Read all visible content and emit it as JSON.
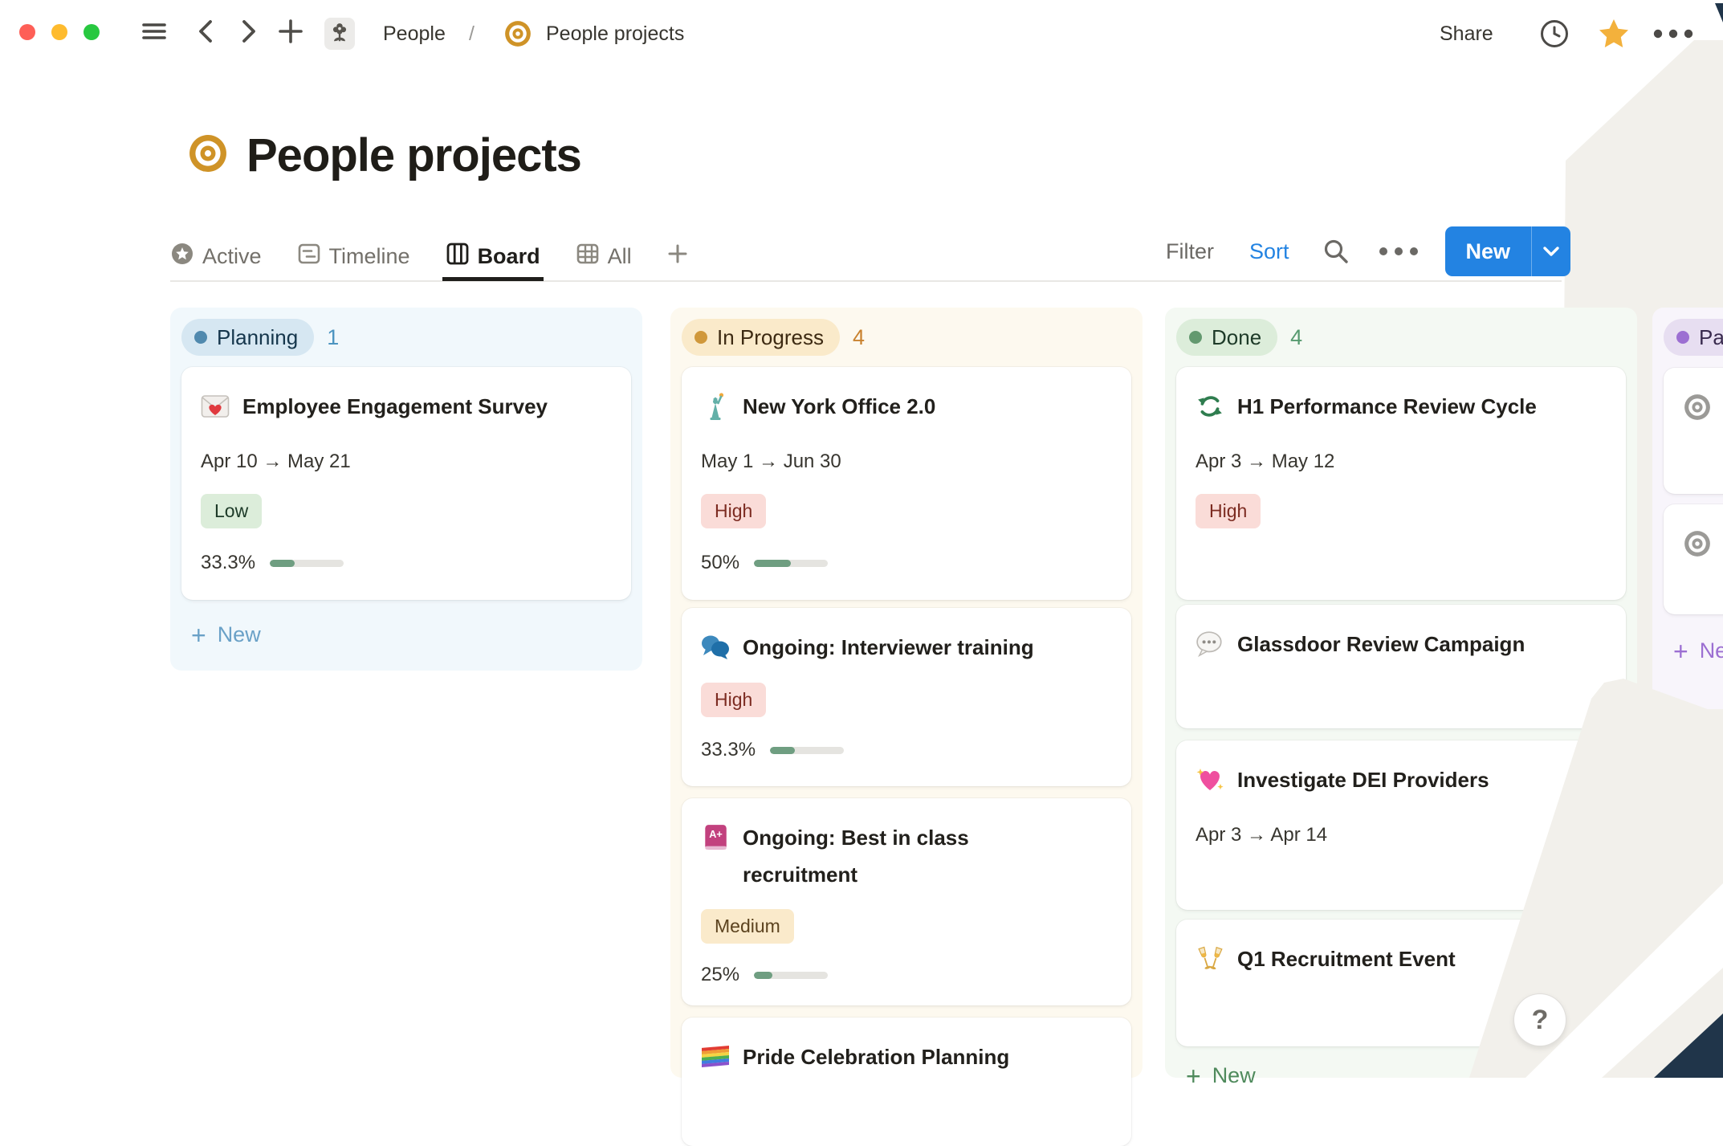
{
  "window": {
    "breadcrumb": {
      "root": "People",
      "separator": "/",
      "page": "People projects"
    },
    "share_label": "Share",
    "traffic_lights": {
      "close": "#fe5f57",
      "minimize": "#febb2e",
      "zoom": "#28c840"
    }
  },
  "header": {
    "title": "People projects",
    "icon": "target-icon"
  },
  "tabs": [
    {
      "label": "Active",
      "icon": "star-circle-icon",
      "active": false
    },
    {
      "label": "Timeline",
      "icon": "timeline-icon",
      "active": false
    },
    {
      "label": "Board",
      "icon": "board-icon",
      "active": true
    },
    {
      "label": "All",
      "icon": "table-icon",
      "active": false
    },
    {
      "label": "+",
      "icon": "plus-icon",
      "active": false
    }
  ],
  "toolbar": {
    "filter_label": "Filter",
    "sort_label": "Sort",
    "sort_color": "#2383e2",
    "new_label": "New",
    "new_button_color": "#2383e2"
  },
  "priorities": {
    "Low": {
      "bg": "#dcedda",
      "fg": "#1d3a28"
    },
    "Medium": {
      "bg": "#faeacb",
      "fg": "#5c431f"
    },
    "High": {
      "bg": "#fadcd8",
      "fg": "#7c2b21"
    }
  },
  "progress_colors": {
    "track": "#e5e4e0",
    "fill": "#6f9e81"
  },
  "board": {
    "columns": [
      {
        "id": "planning",
        "label": "Planning",
        "count": "1",
        "footer": "New",
        "theme": {
          "col_bg": "#f1f8fc",
          "pill_bg": "#d6e7f2",
          "pill_text": "#15364c",
          "dot": "#5089ae",
          "count": "#4c94c0",
          "new": "#6aa1c7"
        },
        "cards": [
          {
            "icon": "love-letter",
            "title": "Employee Engagement Survey",
            "dates": "Apr 10 → May 21",
            "priority": "Low",
            "progress": {
              "label": "33.3%",
              "pct": 33.3
            }
          }
        ]
      },
      {
        "id": "in-progress",
        "label": "In Progress",
        "count": "4",
        "theme": {
          "col_bg": "#fdf9ef",
          "pill_bg": "#faeaca",
          "pill_text": "#3d2a12",
          "dot": "#d0983b",
          "count": "#c9822f",
          "new": "#c9822f"
        },
        "cards": [
          {
            "icon": "statue-of-liberty",
            "title": "New York Office 2.0",
            "dates": "May 1 → Jun 30",
            "priority": "High",
            "progress": {
              "label": "50%",
              "pct": 50
            }
          },
          {
            "icon": "speech-bubbles",
            "title": "Ongoing: Interviewer training",
            "priority": "High",
            "progress": {
              "label": "33.3%",
              "pct": 33.3
            }
          },
          {
            "icon": "a-plus-book",
            "title": "Ongoing: Best in class recruitment",
            "priority": "Medium",
            "progress": {
              "label": "25%",
              "pct": 25
            }
          },
          {
            "icon": "rainbow-flag",
            "title": "Pride Celebration Planning"
          }
        ]
      },
      {
        "id": "done",
        "label": "Done",
        "count": "4",
        "footer": "New",
        "theme": {
          "col_bg": "#f4f9f3",
          "pill_bg": "#dcedda",
          "pill_text": "#1d3a28",
          "dot": "#63996f",
          "count": "#569a6f",
          "new": "#4f8a5c"
        },
        "cards": [
          {
            "icon": "cycle-arrows",
            "title": "H1 Performance Review Cycle",
            "dates": "Apr 3 → May 12",
            "priority": "High"
          },
          {
            "icon": "speech-bubble-dots",
            "title": "Glassdoor Review Campaign"
          },
          {
            "icon": "sparkling-heart",
            "title": "Investigate DEI Providers",
            "dates": "Apr 3 → Apr 14"
          },
          {
            "icon": "champagne-glasses",
            "title": "Q1 Recruitment Event"
          }
        ]
      },
      {
        "id": "paused",
        "label": "Paused",
        "count": "",
        "footer": "New",
        "theme": {
          "col_bg": "#f8f5fb",
          "pill_bg": "#e7def1",
          "pill_text": "#392a4e",
          "dot": "#9c6fd2",
          "count": "#9c6fd2",
          "new": "#9c6fd2"
        },
        "cards": [
          {
            "icon": "target-gray",
            "title": ""
          },
          {
            "icon": "target-gray",
            "title": ""
          }
        ]
      }
    ]
  },
  "help": {
    "label": "?"
  },
  "decor": {
    "beige": "#f2f0eb",
    "navy": "#20354a"
  }
}
